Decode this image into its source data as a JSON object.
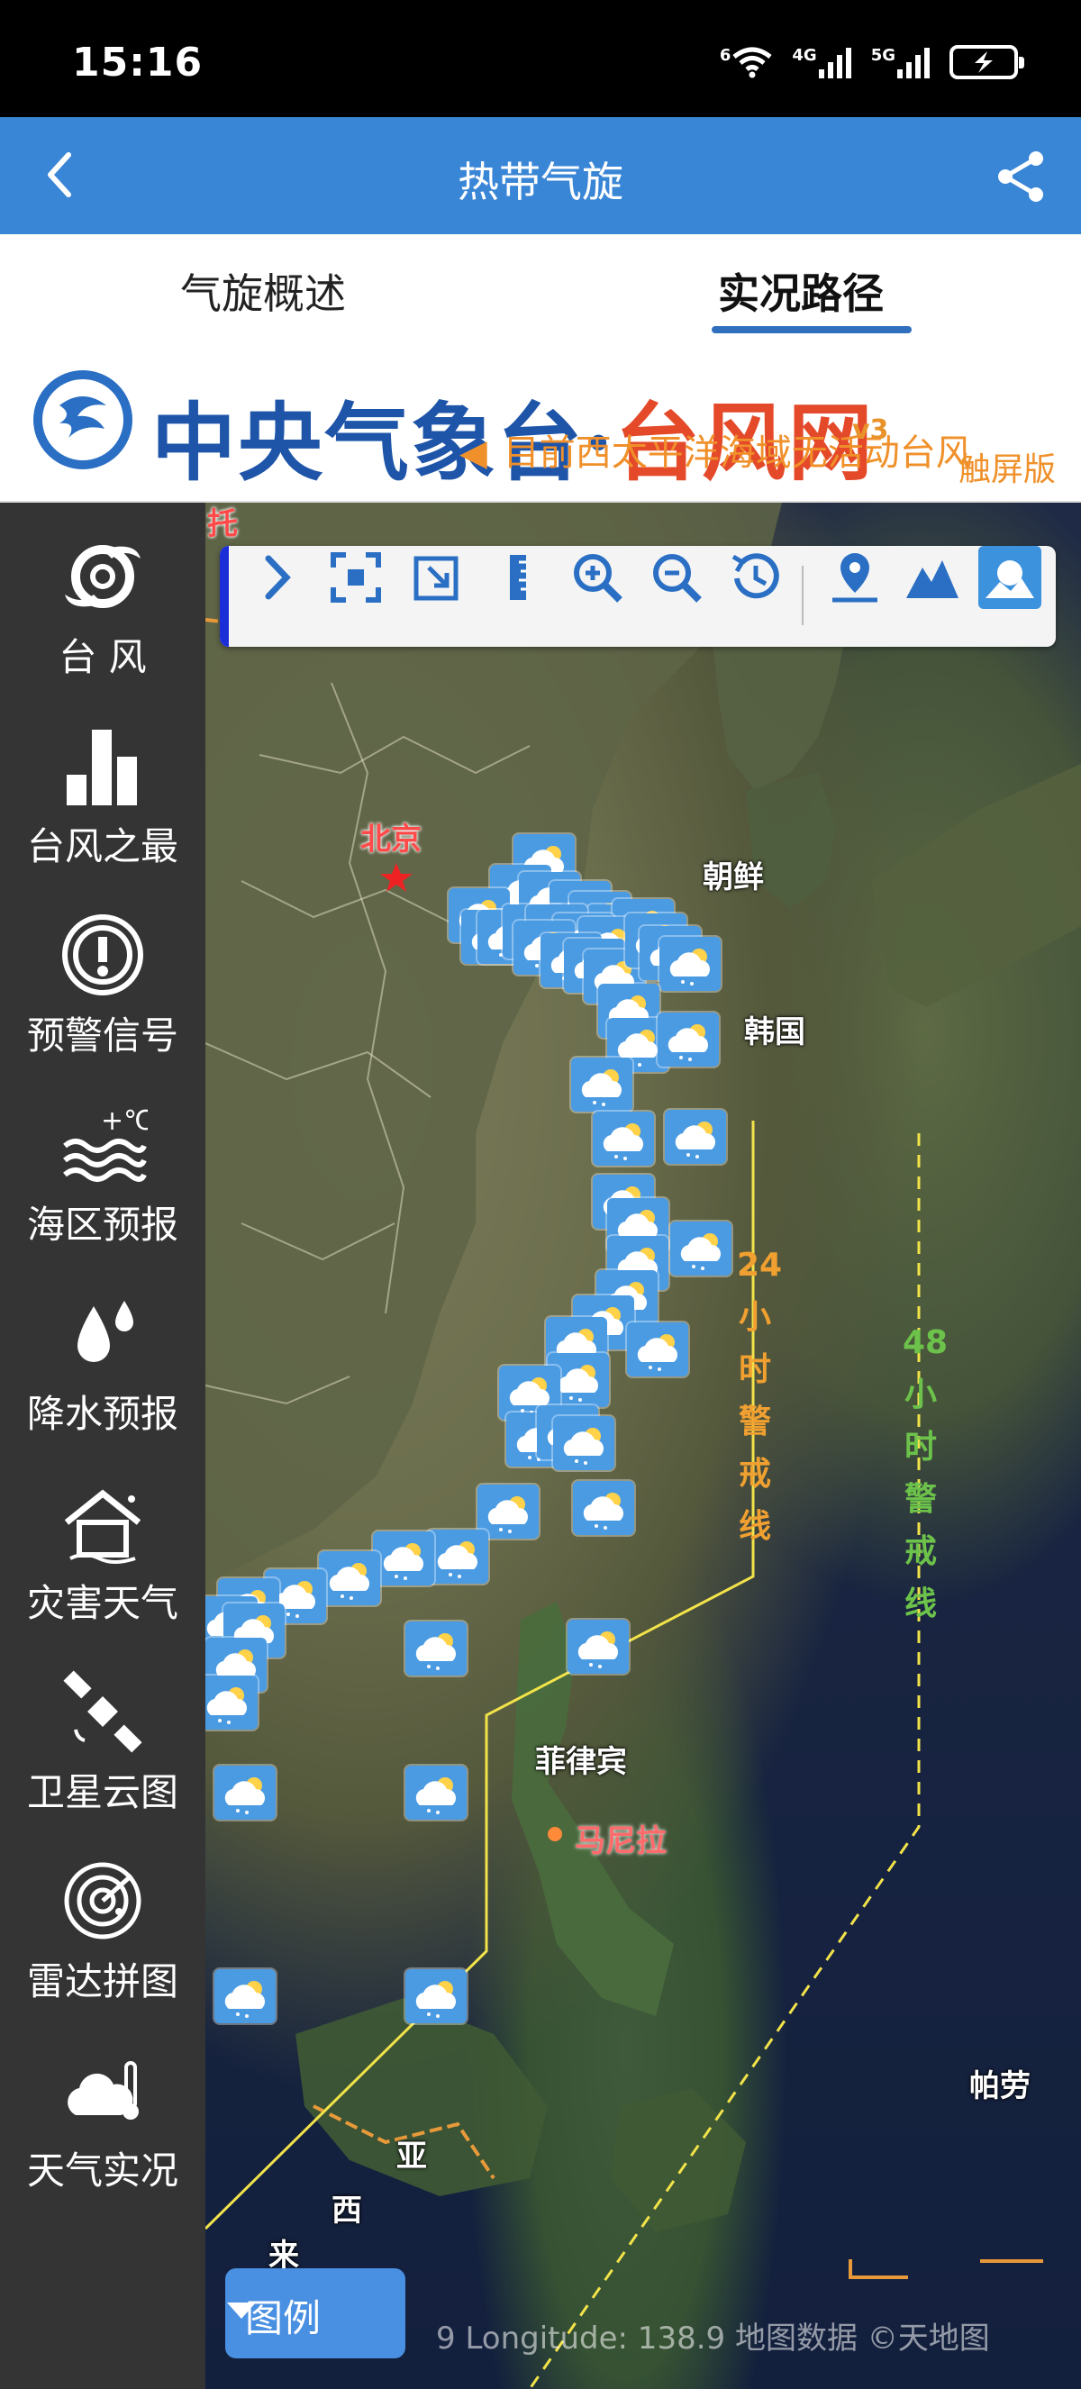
{
  "status_bar": {
    "time": "15:16",
    "wifi_label": "6",
    "signal1_label": "4G",
    "signal2_label": "5G",
    "battery_state": "charging"
  },
  "header": {
    "title": "热带气旋",
    "back_icon": "chevron-left-icon",
    "share_icon": "share-icon"
  },
  "tabs": [
    {
      "label": "气旋概述",
      "active": false
    },
    {
      "label": "实况路径",
      "active": true
    }
  ],
  "banner": {
    "title_blue": "中央气象台",
    "title_dot": "·",
    "title_red": "台风网",
    "version": "v3",
    "marquee": "目前西太平洋海域无活动台风",
    "touch_label": "触屏版"
  },
  "sidebar": {
    "items": [
      {
        "label": "台 风",
        "icon": "typhoon-icon"
      },
      {
        "label": "台风之最",
        "icon": "bar-chart-icon"
      },
      {
        "label": "预警信号",
        "icon": "warning-signal-icon"
      },
      {
        "label": "海区预报",
        "icon": "sea-temp-icon"
      },
      {
        "label": "降水预报",
        "icon": "raindrop-icon"
      },
      {
        "label": "灾害天气",
        "icon": "house-disaster-icon"
      },
      {
        "label": "卫星云图",
        "icon": "satellite-icon"
      },
      {
        "label": "雷达拼图",
        "icon": "radar-icon"
      },
      {
        "label": "天气实况",
        "icon": "cloud-thermometer-icon"
      }
    ]
  },
  "map": {
    "toolbar": [
      "expand-arrow-icon",
      "fullscreen-icon",
      "export-icon",
      "ruler-icon",
      "zoom-in-icon",
      "zoom-out-icon",
      "history-clock-icon",
      "location-pin-icon",
      "terrain-icon",
      "satellite-layer-icon"
    ],
    "labels": {
      "beijing": "北京",
      "north_korea": "朝鲜",
      "south_korea": "韩国",
      "philippines": "菲律宾",
      "manila": "马尼拉",
      "palau": "帕劳",
      "ya": "亚",
      "xi": "西",
      "lai": "来",
      "top_fragment": "托"
    },
    "warning_24": [
      "24",
      "小",
      "时",
      "警",
      "戒",
      "线"
    ],
    "warning_48": [
      "48",
      "小",
      "时",
      "警",
      "戒",
      "线"
    ],
    "legend_label": "图例",
    "coord_text": "9 Longitude: 138.9   地图数据 ©天地图"
  },
  "colors": {
    "header_bg": "#3a86d6",
    "tab_underline": "#2f6fbd",
    "sidebar_bg": "#343434",
    "warning_24": "#f0a030",
    "warning_48": "#6cc24a",
    "weather_icon_bg": "#4b9be3"
  }
}
